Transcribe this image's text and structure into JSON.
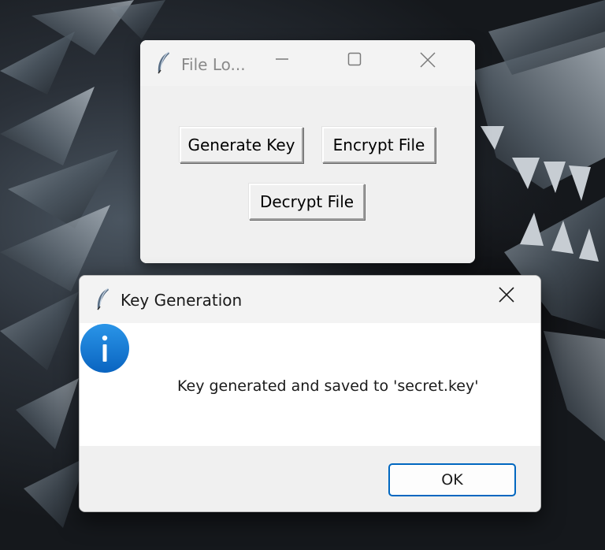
{
  "main_window": {
    "title": "File Lo...",
    "buttons": {
      "generate_key": "Generate Key",
      "encrypt_file": "Encrypt File",
      "decrypt_file": "Decrypt File"
    }
  },
  "dialog": {
    "title": "Key Generation",
    "message": "Key generated and saved to 'secret.key'",
    "ok_label": "OK"
  },
  "colors": {
    "accent": "#0067c0",
    "info_icon": "#1a7fd4"
  },
  "icons": {
    "app_icon": "tk-feather-icon",
    "info": "information-icon"
  }
}
